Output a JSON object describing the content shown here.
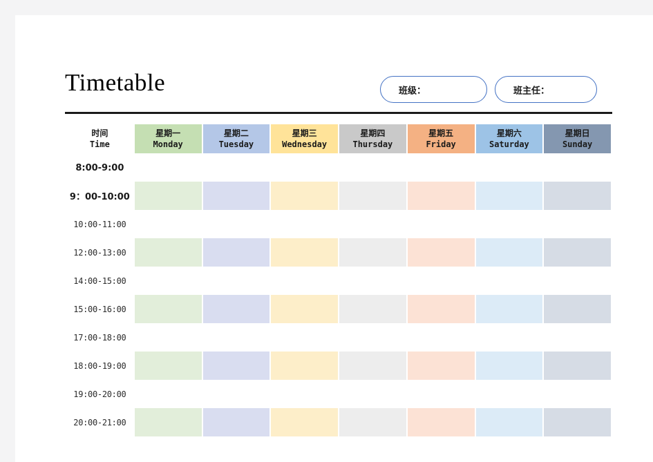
{
  "title": "Timetable",
  "header_fields": [
    {
      "name": "class",
      "label": "班级："
    },
    {
      "name": "head-teacher",
      "label": "班主任："
    }
  ],
  "table": {
    "time_header": {
      "cn": "时间",
      "en": "Time"
    },
    "days": [
      {
        "key": "mon",
        "cn": "星期一",
        "en": "Monday",
        "header_color": "#c5dfb3",
        "body_color": "#e2eeda"
      },
      {
        "key": "tue",
        "cn": "星期二",
        "en": "Tuesday",
        "header_color": "#b4c7e7",
        "body_color": "#d9ddf0"
      },
      {
        "key": "wed",
        "cn": "星期三",
        "en": "Wednesday",
        "header_color": "#ffe399",
        "body_color": "#fdeec9"
      },
      {
        "key": "thu",
        "cn": "星期四",
        "en": "Thursday",
        "header_color": "#c9c9c9",
        "body_color": "#ededed"
      },
      {
        "key": "fri",
        "cn": "星期五",
        "en": "Friday",
        "header_color": "#f4b183",
        "body_color": "#fce2d5"
      },
      {
        "key": "sat",
        "cn": "星期六",
        "en": "Saturday",
        "header_color": "#9dc3e6",
        "body_color": "#dcebf7"
      },
      {
        "key": "sun",
        "cn": "星期日",
        "en": "Sunday",
        "header_color": "#8497b0",
        "body_color": "#d6dce5"
      }
    ],
    "rows": [
      {
        "time": "8:00-9:00",
        "style": "strong",
        "tinted": false
      },
      {
        "time": "9：00-10:00",
        "style": "strong",
        "tinted": true
      },
      {
        "time": "10:00-11:00",
        "style": "plain",
        "tinted": false
      },
      {
        "time": "12:00-13:00",
        "style": "plain",
        "tinted": true
      },
      {
        "time": "14:00-15:00",
        "style": "plain",
        "tinted": false
      },
      {
        "time": "15:00-16:00",
        "style": "plain",
        "tinted": true
      },
      {
        "time": "17:00-18:00",
        "style": "plain",
        "tinted": false
      },
      {
        "time": "18:00-19:00",
        "style": "plain",
        "tinted": true
      },
      {
        "time": "19:00-20:00",
        "style": "plain",
        "tinted": false
      },
      {
        "time": "20:00-21:00",
        "style": "plain",
        "tinted": true
      }
    ]
  },
  "colors": {
    "page_background": "#f4f4f5",
    "sheet_background": "#ffffff",
    "rule": "#1a1a1a",
    "pill_border": "#4472c4"
  }
}
